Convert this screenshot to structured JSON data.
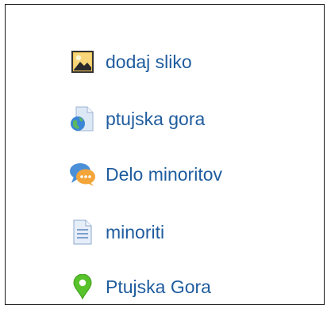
{
  "menu": {
    "items": [
      {
        "label": "dodaj sliko",
        "icon": "image-icon"
      },
      {
        "label": "ptujska gora",
        "icon": "web-page-icon"
      },
      {
        "label": "Delo minoritov",
        "icon": "forum-icon"
      },
      {
        "label": "minoriti",
        "icon": "document-icon"
      },
      {
        "label": "Ptujska Gora",
        "icon": "map-pin-icon"
      }
    ]
  },
  "colors": {
    "link": "#1f5c9e",
    "border": "#1a1a1a"
  }
}
